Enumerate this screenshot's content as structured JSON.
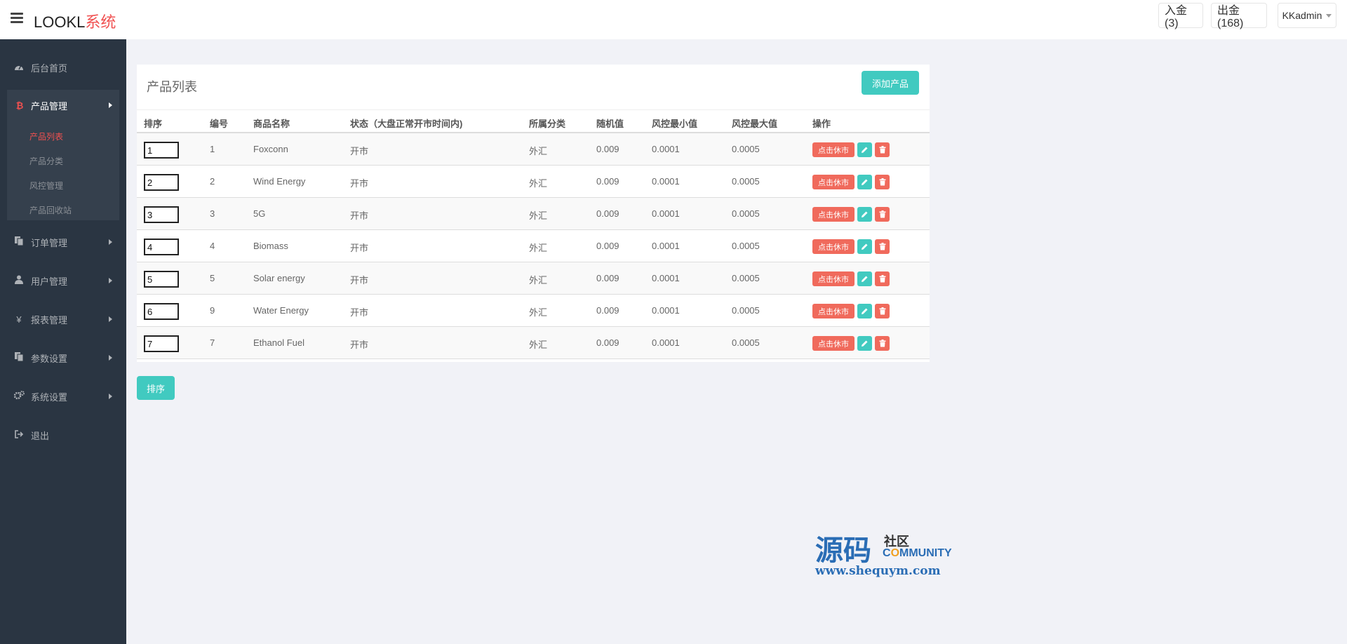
{
  "header": {
    "brand_part1": "LOOKL",
    "brand_part2": "系统",
    "deposit_label": "入金(3)",
    "withdraw_label": "出金(168)",
    "user_label": "KKadmin"
  },
  "sidebar": {
    "home": "后台首页",
    "product_mgmt": "产品管理",
    "product_sub": [
      "产品列表",
      "产品分类",
      "风控管理",
      "产品回收站"
    ],
    "order_mgmt": "订单管理",
    "user_mgmt": "用户管理",
    "report_mgmt": "报表管理",
    "param_settings": "参数设置",
    "system_settings": "系统设置",
    "logout": "退出",
    "yen_symbol": "¥",
    "bitcoin_symbol": "₿"
  },
  "panel": {
    "title": "产品列表",
    "add_button": "添加产品",
    "columns": [
      "排序",
      "编号",
      "商品名称",
      "状态（大盘正常开市时间内)",
      "所属分类",
      "随机值",
      "风控最小值",
      "风控最大值",
      "操作"
    ],
    "rows": [
      {
        "sort": "1",
        "id": "1",
        "name": "Foxconn",
        "status": "开市",
        "category": "外汇",
        "random": "0.009",
        "min": "0.0001",
        "max": "0.0005"
      },
      {
        "sort": "2",
        "id": "2",
        "name": "Wind Energy",
        "status": "开市",
        "category": "外汇",
        "random": "0.009",
        "min": "0.0001",
        "max": "0.0005"
      },
      {
        "sort": "3",
        "id": "3",
        "name": "5G",
        "status": "开市",
        "category": "外汇",
        "random": "0.009",
        "min": "0.0001",
        "max": "0.0005"
      },
      {
        "sort": "4",
        "id": "4",
        "name": "Biomass",
        "status": "开市",
        "category": "外汇",
        "random": "0.009",
        "min": "0.0001",
        "max": "0.0005"
      },
      {
        "sort": "5",
        "id": "5",
        "name": "Solar energy",
        "status": "开市",
        "category": "外汇",
        "random": "0.009",
        "min": "0.0001",
        "max": "0.0005"
      },
      {
        "sort": "6",
        "id": "9",
        "name": "Water Energy",
        "status": "开市",
        "category": "外汇",
        "random": "0.009",
        "min": "0.0001",
        "max": "0.0005"
      },
      {
        "sort": "7",
        "id": "7",
        "name": "Ethanol Fuel",
        "status": "开市",
        "category": "外汇",
        "random": "0.009",
        "min": "0.0001",
        "max": "0.0005"
      }
    ],
    "rest_button": "点击休市",
    "sort_button": "排序"
  },
  "colors": {
    "accent_teal": "#41cac0",
    "accent_red": "#f06a5c",
    "sidebar_bg": "#2a3542",
    "brand_red": "#f05050"
  }
}
